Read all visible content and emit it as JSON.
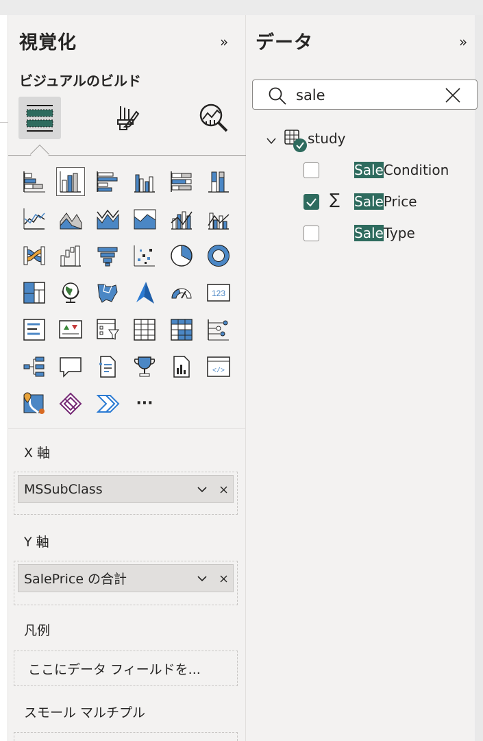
{
  "visualizations": {
    "title": "視覚化",
    "build_title": "ビジュアルのビルド",
    "expand_chevron": "»",
    "tabs": [
      {
        "name": "build-visual-tab",
        "icon": "build-visual-icon",
        "active": true
      },
      {
        "name": "format-visual-tab",
        "icon": "paint-brush-icon",
        "active": false
      },
      {
        "name": "analytics-tab",
        "icon": "analytics-magnifier-icon",
        "active": false
      }
    ],
    "gallery": [
      [
        "stacked-bar-chart-icon",
        "stacked-column-chart-icon",
        "clustered-bar-chart-icon",
        "clustered-column-chart-icon",
        "100-stacked-bar-chart-icon",
        "100-stacked-column-chart-icon"
      ],
      [
        "line-chart-icon",
        "area-chart-icon",
        "stacked-area-chart-icon",
        "100-stacked-area-chart-icon",
        "line-and-stacked-column-icon",
        "line-and-clustered-column-icon"
      ],
      [
        "ribbon-chart-icon",
        "waterfall-chart-icon",
        "funnel-chart-icon",
        "scatter-chart-icon",
        "pie-chart-icon",
        "donut-chart-icon"
      ],
      [
        "treemap-icon",
        "map-globe-icon",
        "filled-map-icon",
        "azure-map-icon",
        "gauge-icon",
        "card-icon"
      ],
      [
        "multi-row-card-icon",
        "kpi-icon",
        "slicer-icon",
        "table-icon",
        "matrix-icon",
        "key-influencers-icon"
      ],
      [
        "decomposition-tree-icon",
        "qa-icon",
        "smart-narrative-icon",
        "metrics-icon",
        "paginated-report-icon",
        "python-visual-icon"
      ],
      [
        "arcgis-map-icon",
        "power-apps-icon",
        "power-automate-icon",
        "more-visuals-icon"
      ]
    ],
    "more_label": "···",
    "selected_visual": "stacked-column-chart-icon",
    "wells": {
      "x_axis": {
        "label": "X 軸",
        "field": "MSSubClass"
      },
      "y_axis": {
        "label": "Y 軸",
        "field": "SalePrice の合計"
      },
      "legend": {
        "label": "凡例",
        "placeholder": "ここにデータ フィールドを..."
      },
      "small_multiples": {
        "label": "スモール マルチプル"
      }
    }
  },
  "data": {
    "title": "データ",
    "expand_chevron": "»",
    "search": {
      "value": "sale"
    },
    "table": {
      "name": "study"
    },
    "fields": [
      {
        "match": "Sale",
        "rest": "Condition",
        "checked": false,
        "sigma": false
      },
      {
        "match": "Sale",
        "rest": "Price",
        "checked": true,
        "sigma": true,
        "sigma_glyph": "∑"
      },
      {
        "match": "Sale",
        "rest": "Type",
        "checked": false,
        "sigma": false
      }
    ]
  },
  "colors": {
    "accent": "#2e6b5e",
    "chart_blue": "#4b87c5",
    "pane_bg": "#f3f2f1"
  }
}
